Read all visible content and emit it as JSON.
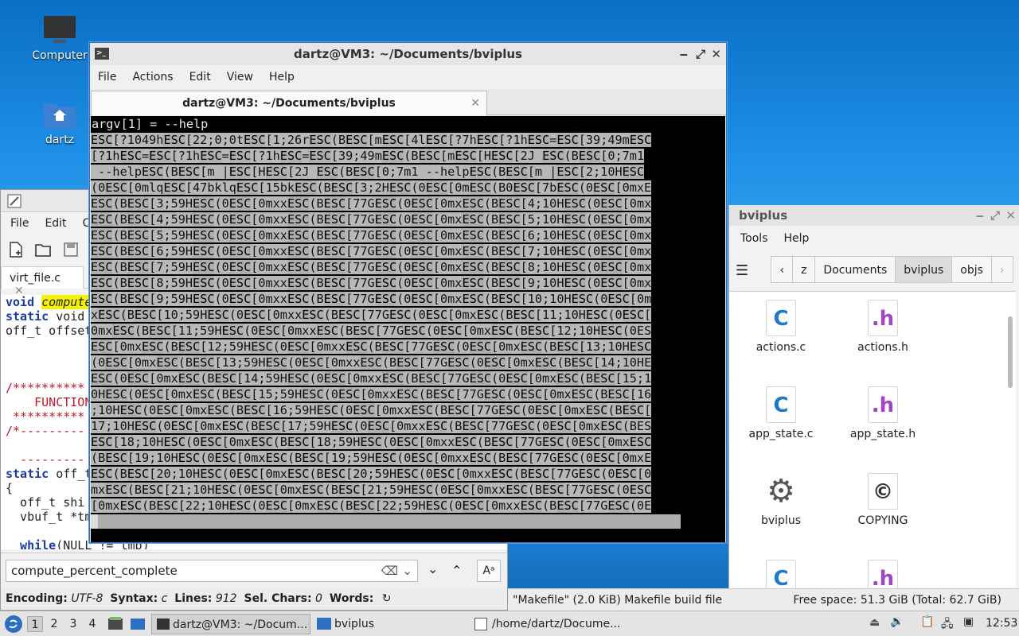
{
  "desktop": {
    "computer_label": "Computer",
    "home_label": "dartz"
  },
  "editor": {
    "menu": [
      "File",
      "Edit",
      "C"
    ],
    "tab_label": "virt_file.c",
    "code_lines": [
      {
        "kw": "void",
        "rest": " ",
        "hl": "compute"
      },
      {
        "kw": "static",
        "rest": " void"
      },
      {
        "kw": "",
        "rest": "off_t offset"
      },
      {
        "kw": "",
        "rest": ""
      },
      {
        "kw": "",
        "rest": ""
      },
      {
        "kw": "",
        "rest": ""
      },
      {
        "cm": "/**********"
      },
      {
        "cm": "    FUNCTION"
      },
      {
        "cm": " **********"
      },
      {
        "cm": "/*---------"
      },
      {
        "kw": "",
        "rest": ""
      },
      {
        "cm": "  ---------"
      },
      {
        "kw": "static",
        "rest": " off_t"
      },
      {
        "kw": "",
        "rest": "{"
      },
      {
        "kw": "",
        "rest": "  off_t shi"
      },
      {
        "kw": "",
        "rest": "  vbuf_t *tm"
      },
      {
        "kw": "",
        "rest": ""
      },
      {
        "kw": "  while",
        "rest": "(NULL != tmp)"
      }
    ],
    "search_value": "compute_percent_complete",
    "status": {
      "encoding_label": "Encoding:",
      "encoding": "UTF-8",
      "syntax_label": "Syntax:",
      "syntax": "c",
      "lines_label": "Lines:",
      "lines": "912",
      "sel_label": "Sel. Chars:",
      "sel": "0",
      "words_label": "Words:"
    }
  },
  "terminal": {
    "title": "dartz@VM3: ~/Documents/bviplus",
    "menu": [
      "File",
      "Actions",
      "Edit",
      "View",
      "Help"
    ],
    "tab_label": "dartz@VM3: ~/Documents/bviplus",
    "first_line": "argv[1] = --help",
    "lines": [
      "ESC[?1049hESC[22;0;0tESC[1;26rESC(BESC[mESC[4lESC[?7hESC[?1hESC=ESC[39;49mESC",
      "[?1hESC=ESC[?1hESC=ESC[?1hESC=ESC[39;49mESC(BESC[mESC[HESC[2J ESC(BESC[0;7m1",
      " --helpESC(BESC[m |ESC[HESC[2J ESC(BESC[0;7m1 --helpESC(BESC[m |ESC[2;10HESC",
      "(0ESC[0mlqESC[47bklqESC[15bkESC(BESC[3;2HESC(0ESC[0mESC(B0ESC[7bESC(0ESC[0mxE",
      "ESC(BESC[3;59HESC(0ESC[0mxxESC(BESC[77GESC(0ESC[0mxESC(BESC[4;10HESC(0ESC[0mx",
      "ESC(BESC[4;59HESC(0ESC[0mxxESC(BESC[77GESC(0ESC[0mxESC(BESC[5;10HESC(0ESC[0mx",
      "ESC(BESC[5;59HESC(0ESC[0mxxESC(BESC[77GESC(0ESC[0mxESC(BESC[6;10HESC(0ESC[0mx",
      "ESC(BESC[6;59HESC(0ESC[0mxxESC(BESC[77GESC(0ESC[0mxESC(BESC[7;10HESC(0ESC[0mx",
      "ESC(BESC[7;59HESC(0ESC[0mxxESC(BESC[77GESC(0ESC[0mxESC(BESC[8;10HESC(0ESC[0mx",
      "ESC(BESC[8;59HESC(0ESC[0mxxESC(BESC[77GESC(0ESC[0mxESC(BESC[9;10HESC(0ESC[0mx",
      "ESC(BESC[9;59HESC(0ESC[0mxxESC(BESC[77GESC(0ESC[0mxESC(BESC[10;10HESC(0ESC[0m",
      "xESC(BESC[10;59HESC(0ESC[0mxxESC(BESC[77GESC(0ESC[0mxESC(BESC[11;10HESC(0ESC[",
      "0mxESC(BESC[11;59HESC(0ESC[0mxxESC(BESC[77GESC(0ESC[0mxESC(BESC[12;10HESC(0ES",
      "ESC[0mxESC(BESC[12;59HESC(0ESC[0mxxESC(BESC[77GESC(0ESC[0mxESC(BESC[13;10HESC",
      "(0ESC[0mxESC(BESC[13;59HESC(0ESC[0mxxESC(BESC[77GESC(0ESC[0mxESC(BESC[14;10HE",
      "ESC(0ESC[0mxESC(BESC[14;59HESC(0ESC[0mxxESC(BESC[77GESC(0ESC[0mxESC(BESC[15;1",
      "0HESC(0ESC[0mxESC(BESC[15;59HESC(0ESC[0mxxESC(BESC[77GESC(0ESC[0mxESC(BESC[16",
      ";10HESC(0ESC[0mxESC(BESC[16;59HESC(0ESC[0mxxESC(BESC[77GESC(0ESC[0mxESC(BESC[",
      "17;10HESC(0ESC[0mxESC(BESC[17;59HESC(0ESC[0mxxESC(BESC[77GESC(0ESC[0mxESC(BES",
      "ESC[18;10HESC(0ESC[0mxESC(BESC[18;59HESC(0ESC[0mxxESC(BESC[77GESC(0ESC[0mxESC",
      "(BESC[19;10HESC(0ESC[0mxESC(BESC[19;59HESC(0ESC[0mxxESC(BESC[77GESC(0ESC[0mxE",
      "ESC(BESC[20;10HESC(0ESC[0mxESC(BESC[20;59HESC(0ESC[0mxxESC(BESC[77GESC(0ESC[0",
      "mxESC(BESC[21;10HESC(0ESC[0mxESC(BESC[21;59HESC(0ESC[0mxxESC(BESC[77GESC(0ESC",
      "[0mxESC(BESC[22;10HESC(0ESC[0mxESC(BESC[22;59HESC(0ESC[0mxxESC(BESC[77GESC(0E"
    ]
  },
  "filemgr": {
    "title": "bviplus",
    "menu": [
      "Tools",
      "Help"
    ],
    "crumbs": [
      "z",
      "Documents",
      "bviplus",
      "objs"
    ],
    "files": [
      {
        "name": "actions.c",
        "type": "C"
      },
      {
        "name": "actions.h",
        "type": "h"
      },
      {
        "name": "app_state.c",
        "type": "C"
      },
      {
        "name": "app_state.h",
        "type": "h"
      },
      {
        "name": "bviplus",
        "type": "gear"
      },
      {
        "name": "COPYING",
        "type": "copy"
      },
      {
        "name": "",
        "type": "C"
      },
      {
        "name": "",
        "type": "h"
      }
    ],
    "status_left": "\"Makefile\" (2.0 KiB) Makefile build file",
    "status_right": "Free space: 51.3 GiB (Total: 62.7 GiB)"
  },
  "taskbar": {
    "workspaces": [
      "1",
      "2",
      "3",
      "4"
    ],
    "tasks": [
      "dartz@VM3: ~/Docum...",
      "bviplus",
      "/home/dartz/Docume..."
    ],
    "clock": "12:53"
  }
}
